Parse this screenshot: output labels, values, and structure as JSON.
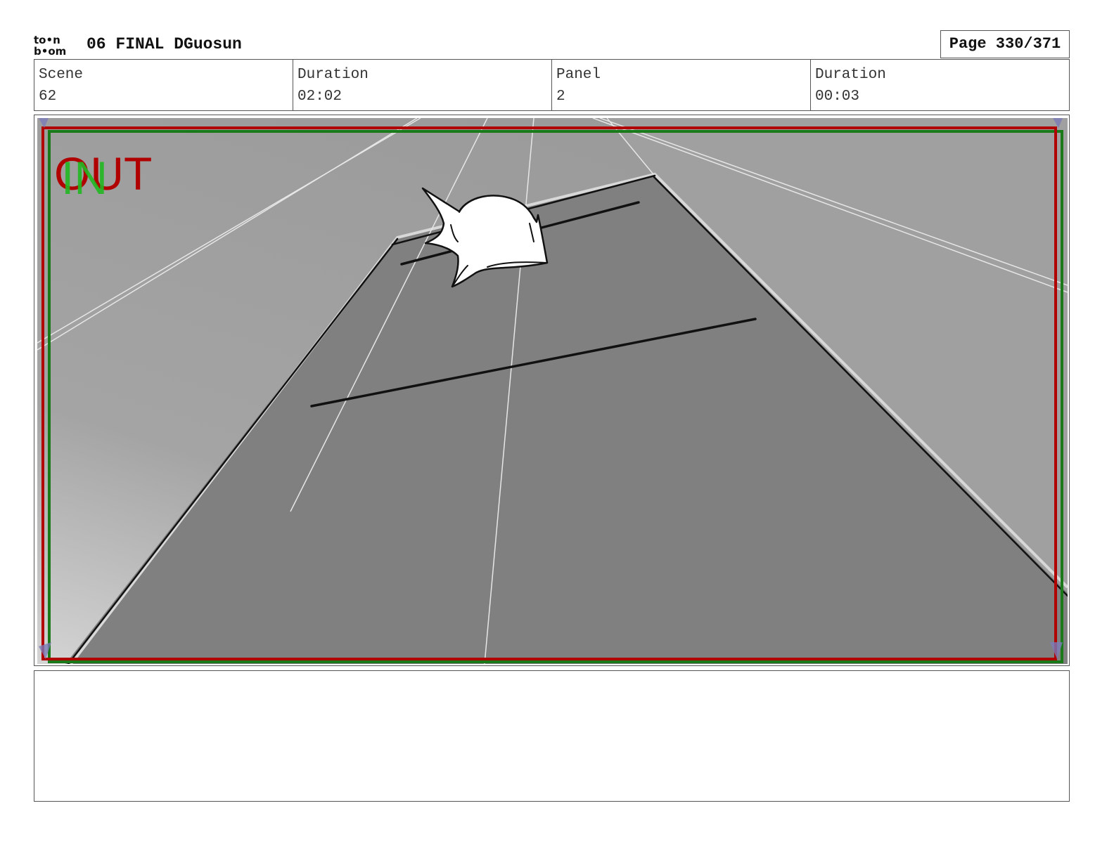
{
  "header": {
    "logo_top": "to•n",
    "logo_bottom": "b•om",
    "project_title": "06 FINAL DGuosun",
    "page_label": "Page 330/371"
  },
  "info": {
    "scene_label": "Scene",
    "scene_value": "62",
    "scene_duration_label": "Duration",
    "scene_duration_value": "02:02",
    "panel_label": "Panel",
    "panel_value": "2",
    "panel_duration_label": "Duration",
    "panel_duration_value": "00:03"
  },
  "panel": {
    "in_label": "IN",
    "out_label": "OUT",
    "colors": {
      "in_frame": "#1a7a1a",
      "out_frame": "#b00000",
      "in_text": "#22b822",
      "out_text": "#b00000",
      "floor": "#808080",
      "wall": "#a0a0a0"
    }
  },
  "notes": {
    "text": ""
  }
}
